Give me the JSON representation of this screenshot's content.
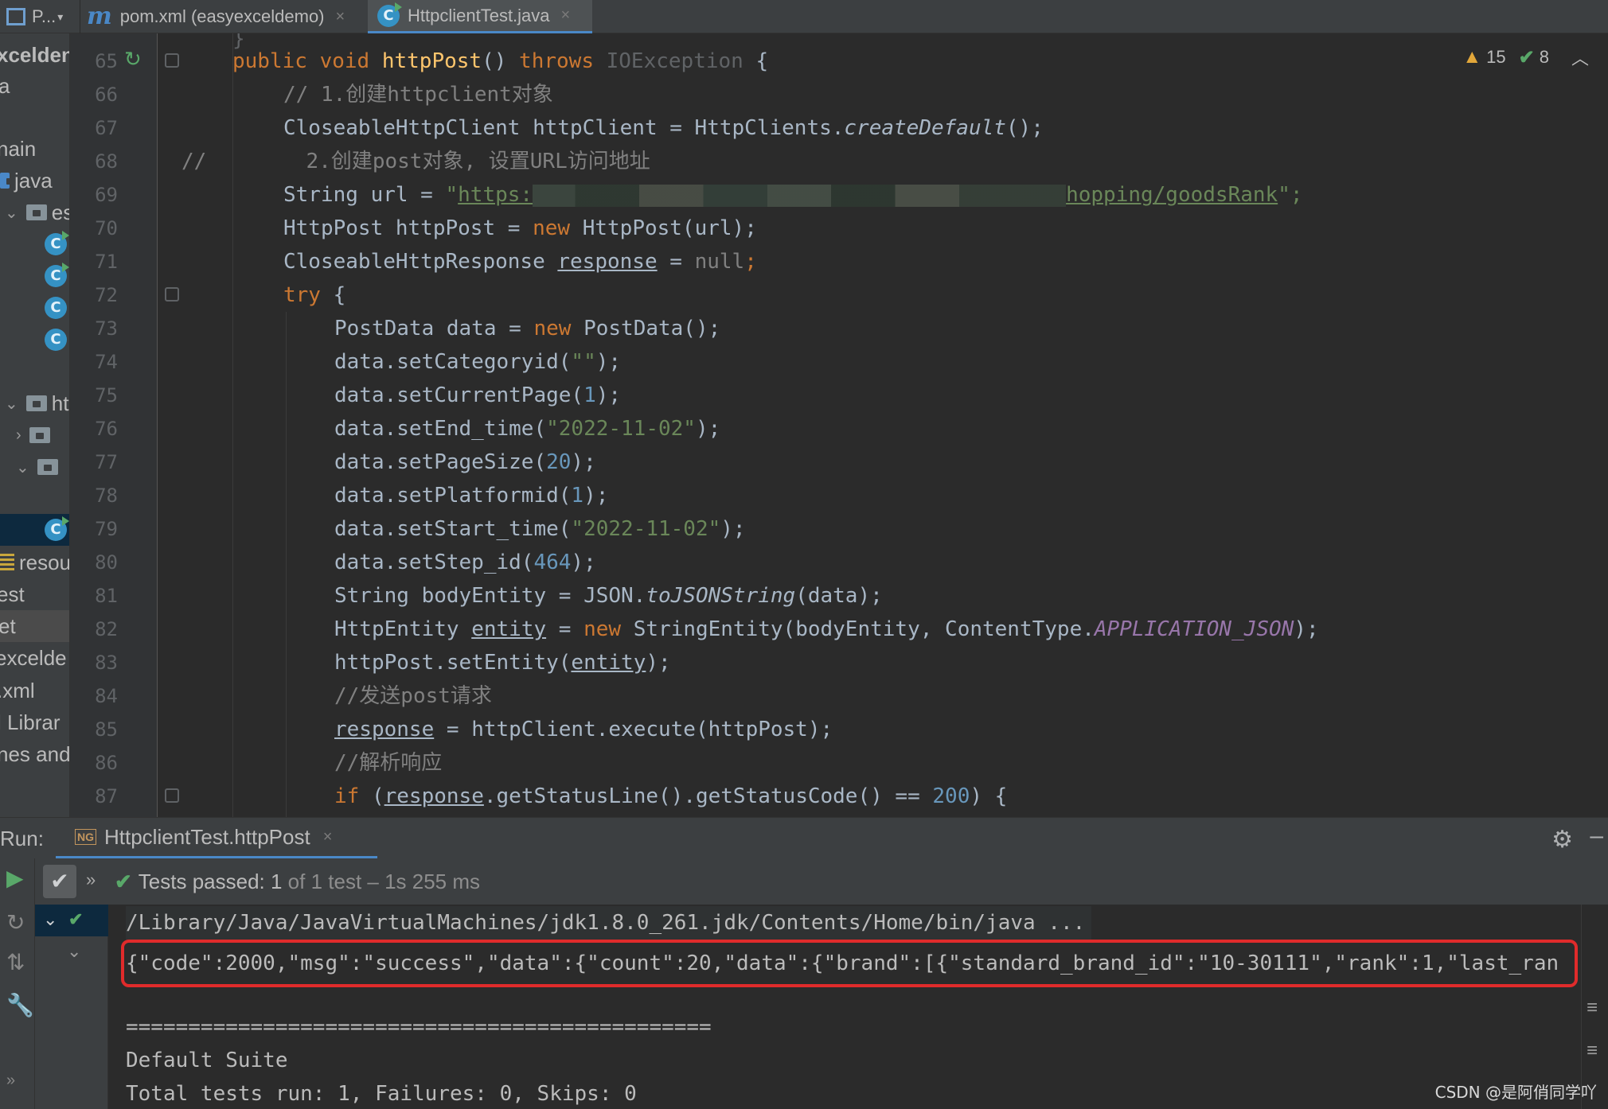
{
  "tabs": {
    "project_label": "P...",
    "pom_label": "pom.xml (easyexceldemo)",
    "java_label": "HttpclientTest.java",
    "close_glyph": "×"
  },
  "sidebar": {
    "items": [
      "xcelden",
      "a",
      "nain",
      "java",
      "es",
      "htt",
      "resou",
      "est",
      "et",
      "excelde",
      ".xml",
      "l Librar",
      "nes and"
    ]
  },
  "editor": {
    "line_numbers": [
      "65",
      "66",
      "67",
      "68",
      "69",
      "70",
      "71",
      "72",
      "73",
      "74",
      "75",
      "76",
      "77",
      "78",
      "79",
      "80",
      "81",
      "82",
      "83",
      "84",
      "85",
      "86",
      "87"
    ],
    "lines": {
      "l65": {
        "a": "public void ",
        "b": "httpPost",
        "c": "() ",
        "d": "throws ",
        "e": "IOException",
        "f": " {"
      },
      "l66": "// 1.创建httpclient对象",
      "l67": {
        "a": "CloseableHttpClient httpClient = HttpClients.",
        "b": "createDefault",
        "c": "();"
      },
      "l68": {
        "a": "//",
        "b": "        2.创建post对象, 设置URL访问地址"
      },
      "l69": {
        "a": "String url = ",
        "b": "\"",
        "c": "https:",
        "d": "hopping/goodsRank",
        "e": "\";"
      },
      "l70": {
        "a": "HttpPost httpPost = ",
        "b": "new ",
        "c": "HttpPost(url);"
      },
      "l71": {
        "a": "CloseableHttpResponse ",
        "b": "response",
        "c": " = ",
        "d": "null",
        "e": ";"
      },
      "l72": {
        "a": "try",
        "b": " {"
      },
      "l73": {
        "a": "PostData data = ",
        "b": "new ",
        "c": "PostData();"
      },
      "l74": {
        "a": "data.setCategoryid(",
        "b": "\"\"",
        "c": ");"
      },
      "l75": {
        "a": "data.setCurrentPage(",
        "b": "1",
        "c": ");"
      },
      "l76": {
        "a": "data.setEnd_time(",
        "b": "\"2022-11-02\"",
        "c": ");"
      },
      "l77": {
        "a": "data.setPageSize(",
        "b": "20",
        "c": ");"
      },
      "l78": {
        "a": "data.setPlatformid(",
        "b": "1",
        "c": ");"
      },
      "l79": {
        "a": "data.setStart_time(",
        "b": "\"2022-11-02\"",
        "c": ");"
      },
      "l80": {
        "a": "data.setStep_id(",
        "b": "464",
        "c": ");"
      },
      "l81": {
        "a": "String bodyEntity = JSON.",
        "b": "toJSONString",
        "c": "(data);"
      },
      "l82": {
        "a": "HttpEntity ",
        "b": "entity",
        "c": " = ",
        "d": "new ",
        "e": "StringEntity(bodyEntity, ContentType.",
        "f": "APPLICATION_JSON",
        "g": ");"
      },
      "l83": {
        "a": "httpPost.setEntity(",
        "b": "entity",
        "c": ");"
      },
      "l84": "//发送post请求",
      "l85": {
        "a": "response",
        "b": " = httpClient.execute(httpPost);"
      },
      "l86": "//解析响应",
      "l87": {
        "a": "if ",
        "b": "(",
        "c": "response",
        "d": ".getStatusLine().getStatusCode() == ",
        "e": "200",
        "f": ") {"
      }
    }
  },
  "inspections": {
    "warnings": "15",
    "checks": "8"
  },
  "run_panel": {
    "label": "Run:",
    "tab_icon": "NG",
    "tab_label": "HttpclientTest.httpPost",
    "status_main": "Tests passed: 1",
    "status_sub": " of 1 test – 1s 255 ms",
    "console": [
      "/Library/Java/JavaVirtualMachines/jdk1.8.0_261.jdk/Contents/Home/bin/java ...",
      "{\"code\":2000,\"msg\":\"success\",\"data\":{\"count\":20,\"data\":{\"brand\":[{\"standard_brand_id\":\"10-30111\",\"rank\":1,\"last_ran",
      "",
      "===============================================",
      "Default Suite",
      "Total tests run: 1, Failures: 0, Skips: 0"
    ]
  },
  "watermark": "CSDN @是阿俏同学吖",
  "colors": {
    "accent": "#4a88c7",
    "keyword": "#cc7832",
    "string": "#6a8759",
    "number": "#6897bb",
    "highlight_box": "#e02b2b"
  }
}
